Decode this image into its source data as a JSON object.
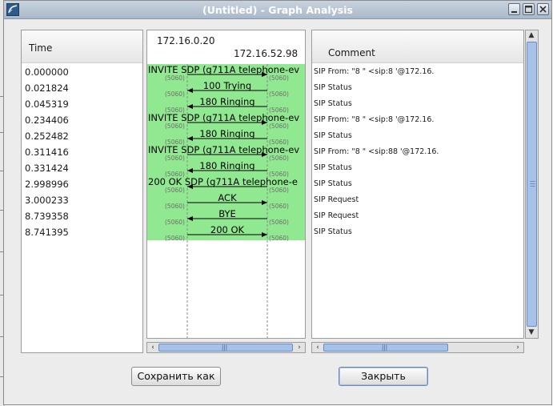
{
  "window": {
    "title": "(Untitled) - Graph Analysis"
  },
  "time_column": {
    "header": "Time",
    "values": [
      "0.000000",
      "0.021824",
      "0.045319",
      "0.234406",
      "0.252482",
      "0.311416",
      "0.331424",
      "2.998996",
      "3.000233",
      "8.739358",
      "8.741395"
    ]
  },
  "graph": {
    "host_left": "172.16.0.20",
    "host_right": "172.16.52.98",
    "port_label": "(5060)",
    "fill_color": "#90e890",
    "messages": [
      {
        "label": "INVITE SDP (g711A telephone-ev",
        "dir": "right"
      },
      {
        "label": "100 Trying",
        "dir": "left"
      },
      {
        "label": "180 Ringing",
        "dir": "left"
      },
      {
        "label": "INVITE SDP (g711A telephone-ev",
        "dir": "right"
      },
      {
        "label": "180 Ringing",
        "dir": "left"
      },
      {
        "label": "INVITE SDP (g711A telephone-ev",
        "dir": "right"
      },
      {
        "label": "180 Ringing",
        "dir": "left"
      },
      {
        "label": "200 OK SDP (g711A telephone-e",
        "dir": "left"
      },
      {
        "label": "ACK",
        "dir": "right"
      },
      {
        "label": "BYE",
        "dir": "left"
      },
      {
        "label": "200 OK",
        "dir": "right"
      }
    ]
  },
  "comment_column": {
    "header": "Comment",
    "values": [
      "SIP From: \"8          \" <sip:8                '@172.16.",
      "SIP Status",
      "SIP Status",
      "SIP From: \"8          \" <sip:8                '@172.16.",
      "SIP Status",
      "SIP From: \"8          \" <sip:88              '@172.16.",
      "SIP Status",
      "SIP Status",
      "SIP Request",
      "SIP Request",
      "SIP Status"
    ]
  },
  "buttons": {
    "save_label": "Сохранить как",
    "close_label": "Закрыть"
  }
}
